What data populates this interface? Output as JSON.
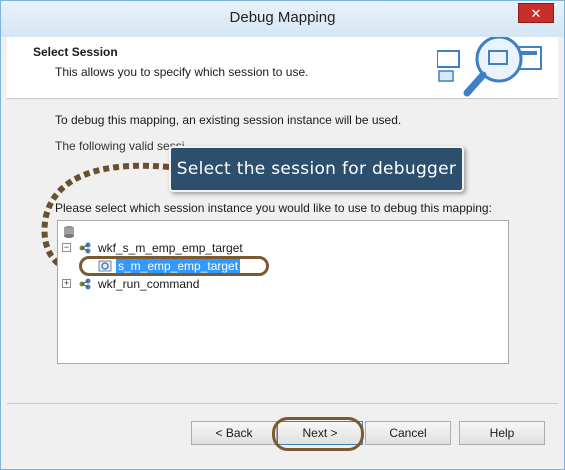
{
  "window": {
    "title": "Debug Mapping",
    "close_glyph": "✕"
  },
  "header": {
    "title": "Select Session",
    "description": "This allows you to specify which session to use."
  },
  "body": {
    "line1": "To debug this mapping, an existing session instance will be used.",
    "line2": "The following valid sessi",
    "prompt": "Please select which session instance you would like to use to debug this mapping:"
  },
  "callout": {
    "text": "Select the session for debugger"
  },
  "tree": {
    "items": [
      {
        "label": "wkf_s_m_emp_emp_target",
        "expander": "−",
        "icon": "workflow-icon"
      },
      {
        "label": "s_m_emp_emp_target",
        "selected": true,
        "icon": "session-icon"
      },
      {
        "label": "wkf_run_command",
        "expander": "+",
        "icon": "workflow-icon"
      }
    ]
  },
  "buttons": {
    "back": "< Back",
    "next": "Next >",
    "cancel": "Cancel",
    "help": "Help"
  },
  "colors": {
    "callout_bg": "#2d4f6e",
    "annotation": "#7a5a2e",
    "selection": "#3399ff"
  }
}
